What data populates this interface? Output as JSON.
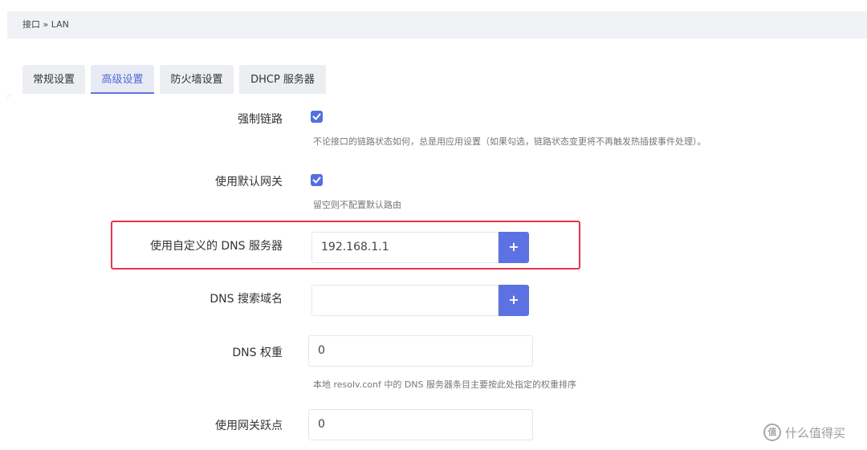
{
  "breadcrumb": "接口 » LAN",
  "tabs": [
    {
      "label": "常规设置"
    },
    {
      "label": "高级设置",
      "active": true
    },
    {
      "label": "防火墙设置"
    },
    {
      "label": "DHCP 服务器"
    }
  ],
  "fields": {
    "force_link": {
      "label": "强制链路",
      "checked": true,
      "desc": "不论接口的链路状态如何，总是用应用设置（如果勾选，链路状态变更将不再触发热插拔事件处理）。"
    },
    "default_gateway": {
      "label": "使用默认网关",
      "checked": true,
      "desc": "留空则不配置默认路由"
    },
    "custom_dns": {
      "label": "使用自定义的 DNS 服务器",
      "value": "192.168.1.1",
      "add_label": "+"
    },
    "dns_search": {
      "label": "DNS 搜索域名",
      "value": "",
      "add_label": "+"
    },
    "dns_weight": {
      "label": "DNS 权重",
      "value": "0",
      "desc": "本地 resolv.conf 中的 DNS 服务器条目主要按此处指定的权重排序"
    },
    "gateway_metric": {
      "label": "使用网关跃点",
      "value": "0"
    }
  },
  "watermark": {
    "icon": "值",
    "text": "什么值得买"
  },
  "colors": {
    "accent": "#5c72e2",
    "highlight_border": "#e8354a"
  }
}
